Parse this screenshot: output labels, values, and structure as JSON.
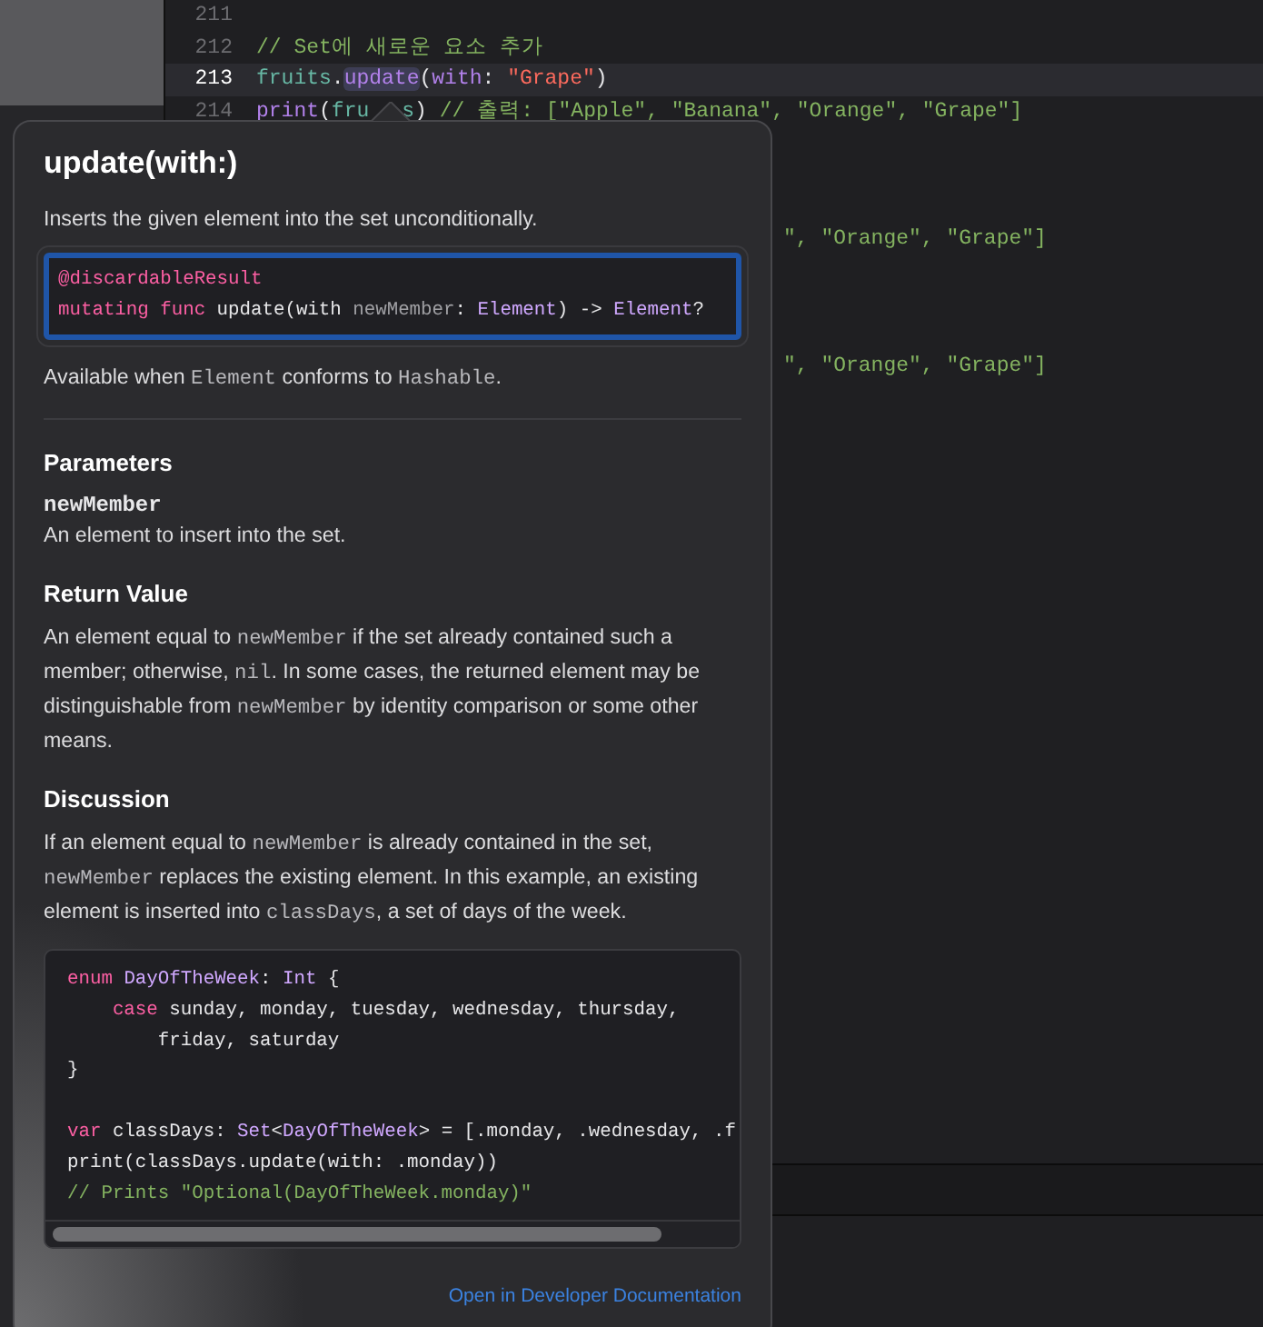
{
  "editor": {
    "lines": [
      {
        "number": "211",
        "current": false
      },
      {
        "number": "212",
        "current": false,
        "tokens": [
          {
            "t": "// Set에 새로운 요소 추가",
            "kind": "comment"
          }
        ]
      },
      {
        "number": "213",
        "current": true,
        "tokens": [
          {
            "t": "fruits",
            "kind": "var"
          },
          {
            "t": ".",
            "kind": "plain"
          },
          {
            "t": "update",
            "kind": "match"
          },
          {
            "t": "(",
            "kind": "plain"
          },
          {
            "t": "with",
            "kind": "fn"
          },
          {
            "t": ": ",
            "kind": "plain"
          },
          {
            "t": "\"Grape\"",
            "kind": "string"
          },
          {
            "t": ")",
            "kind": "plain"
          }
        ]
      },
      {
        "number": "214",
        "current": false,
        "tokens": [
          {
            "t": "print",
            "kind": "fn"
          },
          {
            "t": "(",
            "kind": "plain"
          },
          {
            "t": "fru",
            "kind": "var"
          },
          {
            "t": "s",
            "kind": "covered_before"
          },
          {
            "t": ") ",
            "kind": "plain"
          },
          {
            "t": "// 출력: [\"Apple\", \"Banana\", \"Orange\", \"Grape\"]",
            "kind": "comment"
          }
        ]
      }
    ],
    "fragments": [
      "\", \"Orange\", \"Grape\"]",
      "\", \"Orange\", \"Grape\"]"
    ]
  },
  "popover": {
    "title": "update(with:)",
    "summary": "Inserts the given element into the set unconditionally.",
    "declaration": [
      [
        {
          "t": "@discardableResult",
          "kind": "keyword"
        }
      ],
      [
        {
          "t": "mutating func",
          "kind": "keyword"
        },
        {
          "t": " update(with ",
          "kind": "plain"
        },
        {
          "t": "newMember",
          "kind": "param"
        },
        {
          "t": ": ",
          "kind": "plain"
        },
        {
          "t": "Element",
          "kind": "type"
        },
        {
          "t": ") -> ",
          "kind": "plain"
        },
        {
          "t": "Element",
          "kind": "type"
        },
        {
          "t": "?",
          "kind": "plain"
        }
      ]
    ],
    "availability": [
      {
        "t": "Available when ",
        "kind": "text"
      },
      {
        "t": "Element",
        "kind": "code"
      },
      {
        "t": " conforms to ",
        "kind": "text"
      },
      {
        "t": "Hashable",
        "kind": "code"
      },
      {
        "t": ".",
        "kind": "text"
      }
    ],
    "sections": [
      {
        "kind": "parameters",
        "heading": "Parameters",
        "name": "newMember",
        "text": [
          {
            "t": "An element to insert into the set.",
            "kind": "text"
          }
        ]
      },
      {
        "kind": "text",
        "heading": "Return Value",
        "text": [
          {
            "t": "An element equal to ",
            "kind": "text"
          },
          {
            "t": "newMember",
            "kind": "code"
          },
          {
            "t": " if the set already contained such a member; otherwise, ",
            "kind": "text"
          },
          {
            "t": "nil",
            "kind": "code"
          },
          {
            "t": ". In some cases, the returned element may be distinguishable from ",
            "kind": "text"
          },
          {
            "t": "newMember",
            "kind": "code"
          },
          {
            "t": " by identity comparison or some other means.",
            "kind": "text"
          }
        ]
      },
      {
        "kind": "text",
        "heading": "Discussion",
        "text": [
          {
            "t": "If an element equal to ",
            "kind": "text"
          },
          {
            "t": "newMember",
            "kind": "code"
          },
          {
            "t": " is already contained in the set, ",
            "kind": "text"
          },
          {
            "t": "newMember",
            "kind": "code"
          },
          {
            "t": " replaces the existing element. In this example, an existing element is inserted into ",
            "kind": "text"
          },
          {
            "t": "classDays",
            "kind": "code"
          },
          {
            "t": ", a set of days of the week.",
            "kind": "text"
          }
        ]
      }
    ],
    "example": [
      {
        "kind": "line",
        "tokens": [
          {
            "t": "enum",
            "kind": "keyword"
          },
          {
            "t": " DayOfTheWeek",
            "kind": "type"
          },
          {
            "t": ": ",
            "kind": "plain"
          },
          {
            "t": "Int",
            "kind": "type"
          },
          {
            "t": " {",
            "kind": "plain"
          }
        ]
      },
      {
        "kind": "line",
        "tokens": [
          {
            "t": "    case",
            "kind": "keyword"
          },
          {
            "t": " sunday, monday, tuesday, wednesday, thursday,",
            "kind": "plain"
          }
        ]
      },
      {
        "kind": "line",
        "tokens": [
          {
            "t": "        friday, saturday",
            "kind": "plain"
          }
        ]
      },
      {
        "kind": "line",
        "tokens": [
          {
            "t": "}",
            "kind": "plain"
          }
        ]
      },
      {
        "kind": "after_blank",
        "tokens": [
          {
            "t": "var",
            "kind": "keyword"
          },
          {
            "t": " classDays: ",
            "kind": "plain"
          },
          {
            "t": "Set",
            "kind": "type"
          },
          {
            "t": "<",
            "kind": "plain"
          },
          {
            "t": "DayOfTheWeek",
            "kind": "type"
          },
          {
            "t": "> = [.monday, .wednesday, .f",
            "kind": "plain"
          }
        ]
      },
      {
        "kind": "line",
        "tokens": [
          {
            "t": "print(classDays.update(with: .monday))",
            "kind": "plain"
          }
        ]
      },
      {
        "kind": "line",
        "tokens": [
          {
            "t": "// Prints \"Optional(DayOfTheWeek.monday)\"",
            "kind": "comment"
          }
        ]
      }
    ],
    "link": "Open in Developer Documentation"
  }
}
